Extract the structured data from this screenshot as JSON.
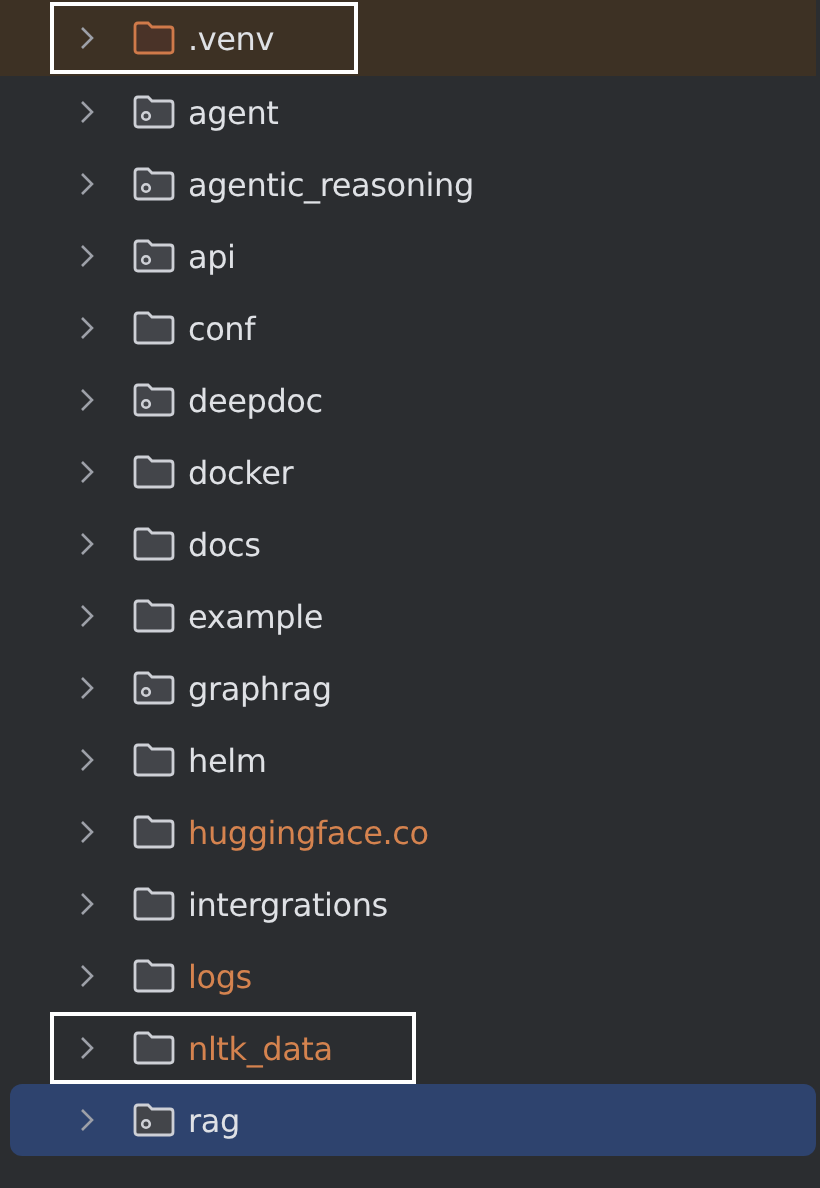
{
  "tree": {
    "items": [
      {
        "label": ".venv",
        "kind": "excluded",
        "selected": false,
        "expanded": false,
        "boxed": true
      },
      {
        "label": "agent",
        "kind": "package",
        "selected": false,
        "expanded": false,
        "boxed": false
      },
      {
        "label": "agentic_reasoning",
        "kind": "package",
        "selected": false,
        "expanded": false,
        "boxed": false
      },
      {
        "label": "api",
        "kind": "package",
        "selected": false,
        "expanded": false,
        "boxed": false
      },
      {
        "label": "conf",
        "kind": "folder",
        "selected": false,
        "expanded": false,
        "boxed": false
      },
      {
        "label": "deepdoc",
        "kind": "package",
        "selected": false,
        "expanded": false,
        "boxed": false
      },
      {
        "label": "docker",
        "kind": "folder",
        "selected": false,
        "expanded": false,
        "boxed": false
      },
      {
        "label": "docs",
        "kind": "folder",
        "selected": false,
        "expanded": false,
        "boxed": false
      },
      {
        "label": "example",
        "kind": "folder",
        "selected": false,
        "expanded": false,
        "boxed": false
      },
      {
        "label": "graphrag",
        "kind": "package",
        "selected": false,
        "expanded": false,
        "boxed": false
      },
      {
        "label": "helm",
        "kind": "folder",
        "selected": false,
        "expanded": false,
        "boxed": false
      },
      {
        "label": "huggingface.co",
        "kind": "ignored",
        "selected": false,
        "expanded": false,
        "boxed": false
      },
      {
        "label": "intergrations",
        "kind": "folder",
        "selected": false,
        "expanded": false,
        "boxed": false
      },
      {
        "label": "logs",
        "kind": "ignored",
        "selected": false,
        "expanded": false,
        "boxed": false
      },
      {
        "label": "nltk_data",
        "kind": "ignored",
        "selected": false,
        "expanded": false,
        "boxed": true
      },
      {
        "label": "rag",
        "kind": "package",
        "selected": true,
        "expanded": false,
        "boxed": false
      }
    ]
  }
}
